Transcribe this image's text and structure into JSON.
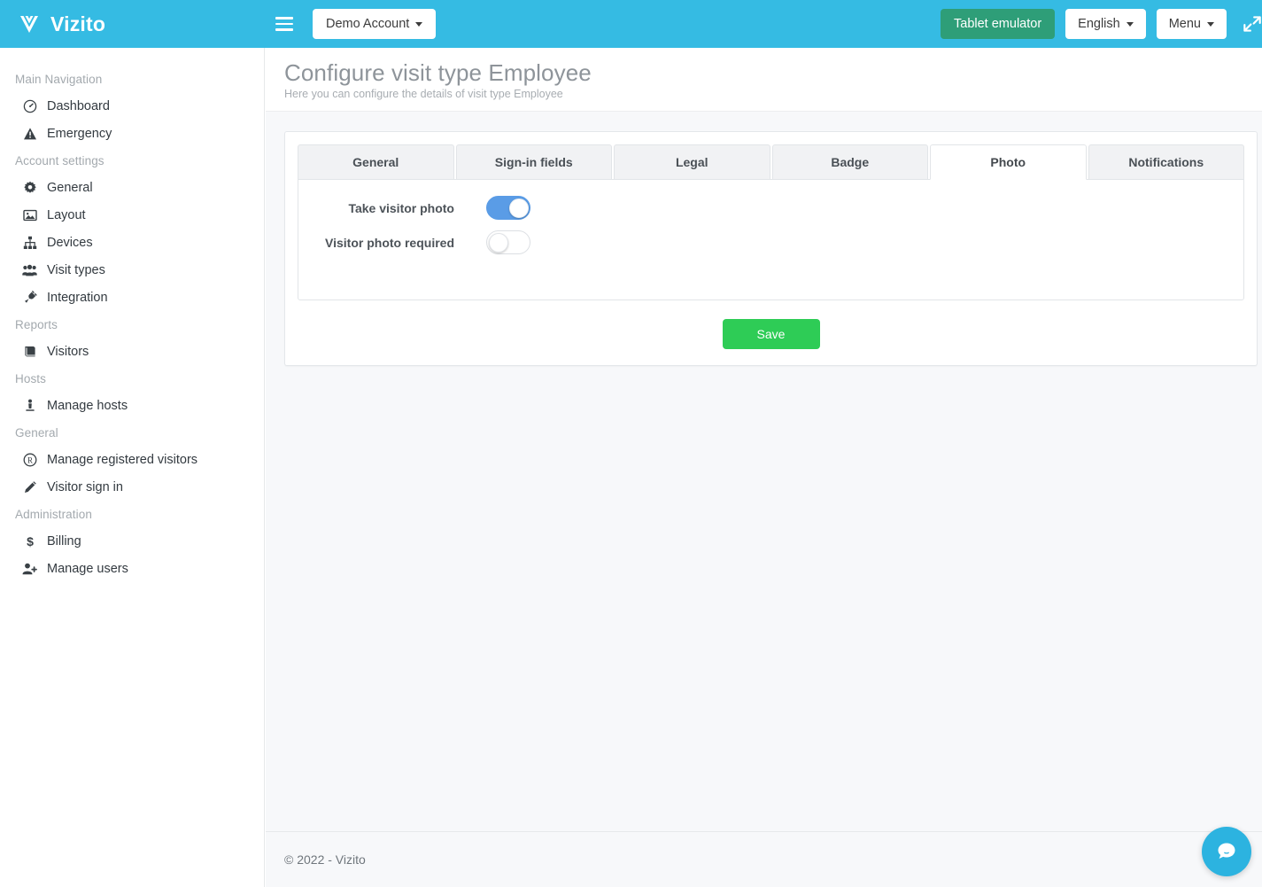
{
  "header": {
    "brand": "Vizito",
    "menu_toggle_icon": "hamburger-icon",
    "account_button": "Demo Account",
    "tablet_emulator_button": "Tablet emulator",
    "language_button": "English",
    "menu_button": "Menu",
    "expand_icon": "expand-fullscreen-icon",
    "background_color": "#35bbe3",
    "emulator_color": "#2e9e78"
  },
  "sidebar": {
    "sections": [
      {
        "title": "Main Navigation",
        "items": [
          {
            "label": "Dashboard",
            "icon": "dashboard-gauge-icon"
          },
          {
            "label": "Emergency",
            "icon": "warning-triangle-icon"
          }
        ]
      },
      {
        "title": "Account settings",
        "items": [
          {
            "label": "General",
            "icon": "gear-icon"
          },
          {
            "label": "Layout",
            "icon": "image-icon"
          },
          {
            "label": "Devices",
            "icon": "sitemap-icon"
          },
          {
            "label": "Visit types",
            "icon": "users-group-icon"
          },
          {
            "label": "Integration",
            "icon": "plug-icon"
          }
        ]
      },
      {
        "title": "Reports",
        "items": [
          {
            "label": "Visitors",
            "icon": "book-icon"
          }
        ]
      },
      {
        "title": "Hosts",
        "items": [
          {
            "label": "Manage hosts",
            "icon": "host-person-icon"
          }
        ]
      },
      {
        "title": "General",
        "items": [
          {
            "label": "Manage registered visitors",
            "icon": "registered-r-icon"
          },
          {
            "label": "Visitor sign in",
            "icon": "pencil-icon"
          }
        ]
      },
      {
        "title": "Administration",
        "items": [
          {
            "label": "Billing",
            "icon": "dollar-icon"
          },
          {
            "label": "Manage users",
            "icon": "user-plus-icon"
          }
        ]
      }
    ]
  },
  "page": {
    "title": "Configure visit type Employee",
    "subtitle": "Here you can configure the details of visit type Employee"
  },
  "tabs": [
    {
      "label": "General",
      "active": false
    },
    {
      "label": "Sign-in fields",
      "active": false
    },
    {
      "label": "Legal",
      "active": false
    },
    {
      "label": "Badge",
      "active": false
    },
    {
      "label": "Photo",
      "active": true
    },
    {
      "label": "Notifications",
      "active": false
    }
  ],
  "photo_tab": {
    "settings": [
      {
        "label": "Take visitor photo",
        "value": "on"
      },
      {
        "label": "Visitor photo required",
        "value": "off"
      }
    ],
    "toggle_on_color": "#5a9ce6"
  },
  "actions": {
    "save_label": "Save",
    "save_color": "#2ecc56"
  },
  "footer": {
    "copyright": "© 2022 - Vizito"
  },
  "chat": {
    "icon": "chat-bubble-icon",
    "color": "#2cb3e0"
  }
}
